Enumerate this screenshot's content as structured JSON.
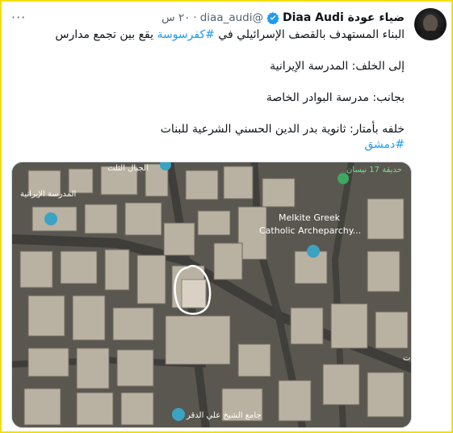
{
  "tweet": {
    "display_name": "ضياء عودة Diaa Audi",
    "handle": "@diaa_audi",
    "separator": "·",
    "time": "٢٠ س",
    "more_label": "···",
    "lines": [
      {
        "before": "البناء المستهدف بالقصف الإسرائيلي في ",
        "hashtag": "#كفرسوسة",
        "after": " يقع بين تجمع مدارس"
      },
      {
        "before": "إلى الخلف: المدرسة الإيرانية",
        "hashtag": "",
        "after": ""
      },
      {
        "before": "بجانب: مدرسة البوادر الخاصة",
        "hashtag": "",
        "after": ""
      },
      {
        "before": "خلفه بأمتار: ثانوية بدر الدين الحسني الشرعية للبنات",
        "hashtag": "",
        "after": ""
      },
      {
        "before": "",
        "hashtag": "#دمشق",
        "after": ""
      }
    ]
  },
  "map": {
    "labels": {
      "iranian_school": "المدرسة الإيرانية",
      "top_label": "الجبال الثلث",
      "church_line1": "Melkite Greek",
      "church_line2": "Catholic Archeparchy...",
      "garden": "حديقة 17 نيسان",
      "mosque": "جامع الشيخ علي الدقر",
      "right_edge": "ات"
    }
  },
  "colors": {
    "hashtag": "#1d9bf0",
    "verified": "#1d9bf0",
    "frame": "#f2e000"
  }
}
